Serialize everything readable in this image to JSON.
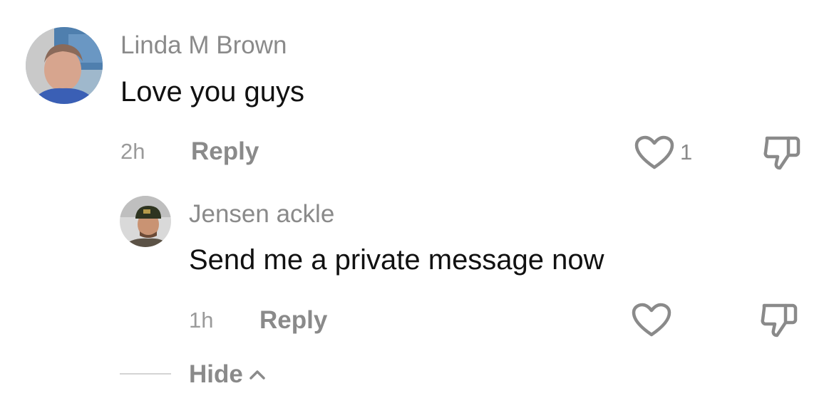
{
  "comments": [
    {
      "username": "Linda M Brown",
      "text": "Love you guys",
      "timestamp": "2h",
      "reply_label": "Reply",
      "like_count": "1",
      "avatar_icon": "user-avatar-linda"
    }
  ],
  "replies": [
    {
      "username": "Jensen ackle",
      "text": "Send me a private message now",
      "timestamp": "1h",
      "reply_label": "Reply",
      "like_count": "",
      "avatar_icon": "user-avatar-jensen"
    }
  ],
  "thread_controls": {
    "hide_label": "Hide",
    "hide_icon": "chevron-up-icon"
  },
  "icons": {
    "like": "heart-outline-icon",
    "dislike": "thumbs-down-icon"
  },
  "colors": {
    "muted_text": "#8a8a8a",
    "primary_text": "#111111",
    "background": "#ffffff"
  }
}
